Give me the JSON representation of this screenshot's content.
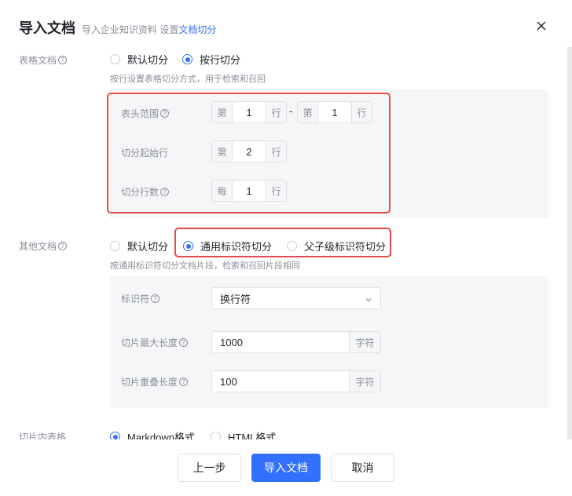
{
  "header": {
    "title": "导入文档",
    "subtitle": "导入企业知识资料 设置",
    "subtitle_link": "文档切分"
  },
  "table_docs": {
    "label": "表格文档",
    "options": [
      "默认切分",
      "按行切分"
    ],
    "selected": "按行切分",
    "hint": "按行设置表格切分方式，用于检索和召回",
    "header_range": {
      "label": "表头范围",
      "prefix": "第",
      "from": "1",
      "suffix": "行",
      "separator": "-",
      "to": "1"
    },
    "start_row": {
      "label": "切分起始行",
      "prefix": "第",
      "value": "2",
      "suffix": "行"
    },
    "row_count": {
      "label": "切分行数",
      "prefix": "每",
      "value": "1",
      "suffix": "行"
    }
  },
  "other_docs": {
    "label": "其他文档",
    "options": [
      "默认切分",
      "通用标识符切分",
      "父子级标识符切分"
    ],
    "selected": "通用标识符切分",
    "hint": "按通用标识符切分文档片段，检索和召回片段相同",
    "identifier": {
      "label": "标识符",
      "value": "换行符"
    },
    "max_length": {
      "label": "切片最大长度",
      "value": "1000",
      "unit": "字符"
    },
    "overlap_length": {
      "label": "切片重叠长度",
      "value": "100",
      "unit": "字符"
    }
  },
  "slice_table": {
    "label": "切片内表格",
    "options": [
      "Markdown格式",
      "HTML格式"
    ],
    "selected": "Markdown格式"
  },
  "footer": {
    "prev": "上一步",
    "import": "导入文档",
    "cancel": "取消"
  },
  "colors": {
    "primary": "#3370ff",
    "highlight": "#e34a4a",
    "panel": "#f5f6f7"
  }
}
